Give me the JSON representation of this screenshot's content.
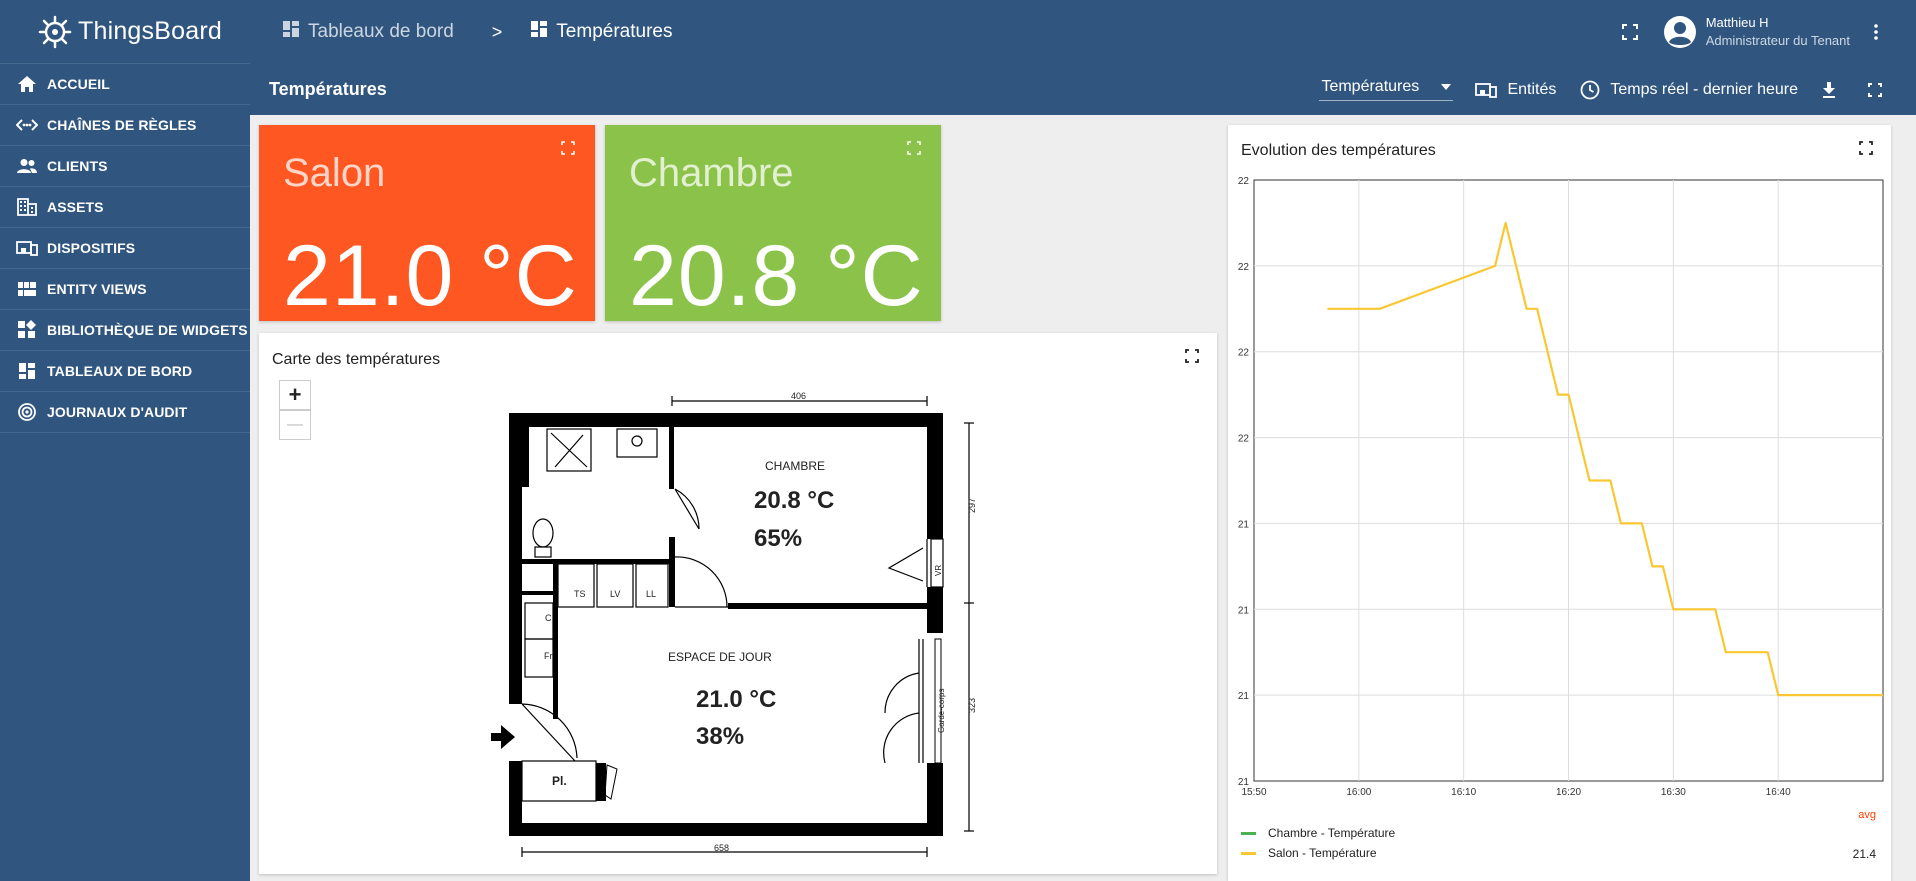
{
  "app": {
    "logo_text": "ThingsBoard"
  },
  "sidebar": {
    "items": [
      {
        "label": "ACCUEIL",
        "icon": "home-icon"
      },
      {
        "label": "CHAÎNES DE RÈGLES",
        "icon": "rule-chain-icon"
      },
      {
        "label": "CLIENTS",
        "icon": "clients-icon"
      },
      {
        "label": "ASSETS",
        "icon": "assets-icon"
      },
      {
        "label": "DISPOSITIFS",
        "icon": "devices-icon"
      },
      {
        "label": "ENTITY VIEWS",
        "icon": "entity-views-icon"
      },
      {
        "label": "BIBLIOTHÈQUE DE WIDGETS",
        "icon": "widgets-library-icon"
      },
      {
        "label": "TABLEAUX DE BORD",
        "icon": "dashboards-icon"
      },
      {
        "label": "JOURNAUX D'AUDIT",
        "icon": "audit-logs-icon"
      }
    ]
  },
  "topbar": {
    "breadcrumb": [
      "Tableaux de bord",
      "Températures"
    ],
    "separator": ">",
    "user_name": "Matthieu H",
    "user_role": "Administrateur du Tenant"
  },
  "dashboard": {
    "title": "Températures",
    "state_select": "Températures",
    "entities_label": "Entités",
    "timewindow_label": "Temps réel - dernier heure"
  },
  "cards": {
    "salon": {
      "title": "Salon",
      "value": "21.0 °C",
      "color": "#ff5722"
    },
    "chambre": {
      "title": "Chambre",
      "value": "20.8 °C",
      "color": "#8bc34a"
    }
  },
  "map": {
    "title": "Carte des températures",
    "zoom_in": "+",
    "zoom_out": "—",
    "floorplan": {
      "dim_top": "406",
      "dim_bottom": "658",
      "dim_right_top": "297",
      "dim_right_bottom": "323",
      "room_chambre": "CHAMBRE",
      "chambre_temp": "20.8 °C",
      "chambre_humidity": "65%",
      "room_jour": "ESPACE DE JOUR",
      "jour_temp": "21.0 °C",
      "jour_humidity": "38%",
      "label_ts": "TS",
      "label_lv": "LV",
      "label_ll": "LL",
      "label_c": "C",
      "label_fr": "Fr",
      "label_pl": "Pl.",
      "label_vr": "VR",
      "label_garde_corps": "Garde-corps"
    }
  },
  "chart": {
    "title": "Evolution des températures",
    "legend_header": "avg",
    "legend": [
      {
        "name": "Chambre - Température",
        "color": "#4caf50",
        "avg": ""
      },
      {
        "name": "Salon - Température",
        "color": "#f9c732",
        "avg": "21.4"
      }
    ]
  },
  "chart_data": {
    "type": "line",
    "title": "Evolution des températures",
    "x_ticks": [
      "15:50",
      "16:00",
      "16:10",
      "16:20",
      "16:30",
      "16:40"
    ],
    "y_ticks": [
      "21",
      "21",
      "21",
      "21",
      "22",
      "22",
      "22",
      "22"
    ],
    "ylim": [
      21.0,
      21.7
    ],
    "xlim": [
      "15:50",
      "16:50"
    ],
    "grid": true,
    "legend_placement": "bottom",
    "series": [
      {
        "name": "Chambre - Température",
        "color": "#4caf50",
        "points": []
      },
      {
        "name": "Salon - Température",
        "color": "#f9c732",
        "points": [
          [
            "15:57",
            21.55
          ],
          [
            "16:00",
            21.55
          ],
          [
            "16:02",
            21.55
          ],
          [
            "16:13",
            21.6
          ],
          [
            "16:14",
            21.65
          ],
          [
            "16:16",
            21.55
          ],
          [
            "16:17",
            21.55
          ],
          [
            "16:19",
            21.45
          ],
          [
            "16:20",
            21.45
          ],
          [
            "16:22",
            21.35
          ],
          [
            "16:24",
            21.35
          ],
          [
            "16:25",
            21.3
          ],
          [
            "16:27",
            21.3
          ],
          [
            "16:28",
            21.25
          ],
          [
            "16:29",
            21.25
          ],
          [
            "16:30",
            21.2
          ],
          [
            "16:34",
            21.2
          ],
          [
            "16:35",
            21.15
          ],
          [
            "16:39",
            21.15
          ],
          [
            "16:40",
            21.1
          ],
          [
            "16:50",
            21.1
          ]
        ]
      }
    ]
  }
}
